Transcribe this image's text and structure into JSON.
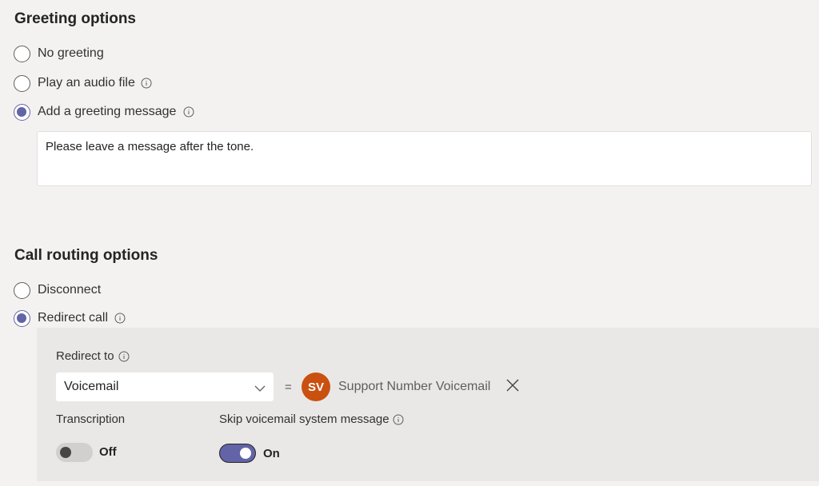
{
  "greeting": {
    "title": "Greeting options",
    "options": [
      {
        "label": "No greeting",
        "checked": false,
        "info": false
      },
      {
        "label": "Play an audio file",
        "checked": false,
        "info": true
      },
      {
        "label": "Add a greeting message",
        "checked": true,
        "info": true
      }
    ],
    "message": "Please leave a message after the tone."
  },
  "routing": {
    "title": "Call routing options",
    "options": [
      {
        "label": "Disconnect",
        "checked": false,
        "info": false
      },
      {
        "label": "Redirect call",
        "checked": true,
        "info": true
      }
    ],
    "redirect_to_label": "Redirect to",
    "redirect_selected": "Voicemail",
    "equals": "=",
    "target_initials": "SV",
    "target_name": "Support Number Voicemail",
    "transcription_label": "Transcription",
    "transcription_state": "Off",
    "skip_label": "Skip voicemail system message",
    "skip_state": "On"
  },
  "colors": {
    "accent": "#6264a7",
    "avatar": "#ca5010",
    "background": "#f3f2f1",
    "panel": "#e9e8e7"
  },
  "icons": {
    "info": "info-icon",
    "dropdown": "chevron-down-icon",
    "remove": "close-icon"
  }
}
